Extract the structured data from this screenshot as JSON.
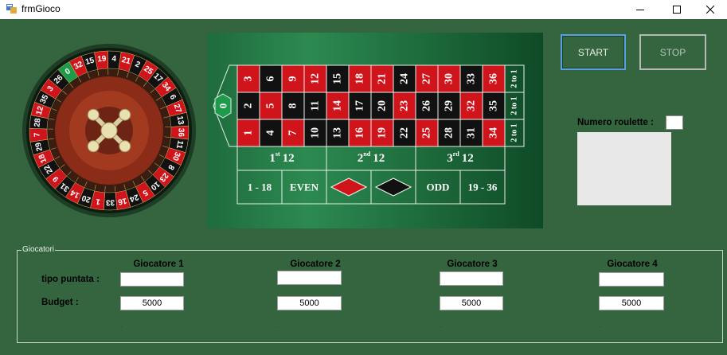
{
  "window": {
    "title": "frmGioco"
  },
  "wheel": {
    "numbers": [
      "0",
      "32",
      "15",
      "19",
      "4",
      "21",
      "2",
      "25",
      "17",
      "34",
      "6",
      "27",
      "13",
      "36",
      "11",
      "30",
      "8",
      "23",
      "10",
      "5",
      "24",
      "16",
      "33",
      "1",
      "20",
      "14",
      "31",
      "9",
      "22",
      "18",
      "29",
      "7",
      "28",
      "12",
      "35",
      "3",
      "26"
    ]
  },
  "board": {
    "zero": "0",
    "rows": [
      [
        "3",
        "6",
        "9",
        "12",
        "15",
        "18",
        "21",
        "24",
        "27",
        "30",
        "33",
        "36"
      ],
      [
        "2",
        "5",
        "8",
        "11",
        "14",
        "17",
        "20",
        "23",
        "26",
        "29",
        "32",
        "35"
      ],
      [
        "1",
        "4",
        "7",
        "10",
        "13",
        "16",
        "19",
        "22",
        "25",
        "28",
        "31",
        "34"
      ]
    ],
    "red_numbers": [
      "1",
      "3",
      "5",
      "7",
      "9",
      "12",
      "14",
      "16",
      "18",
      "19",
      "21",
      "23",
      "25",
      "27",
      "30",
      "32",
      "34",
      "36"
    ],
    "column_bets": [
      "2 to 1",
      "2 to 1",
      "2 to 1"
    ],
    "dozens": [
      {
        "num": "1",
        "sup": "st",
        "label": "12"
      },
      {
        "num": "2",
        "sup": "nd",
        "label": "12"
      },
      {
        "num": "3",
        "sup": "rd",
        "label": "12"
      }
    ],
    "outside": [
      "1 - 18",
      "EVEN",
      "",
      "",
      "ODD",
      "19 - 36"
    ],
    "colors": {
      "red": "#d0141c",
      "black": "#111111",
      "green": "#1e9b4a"
    }
  },
  "controls": {
    "start_label": "START",
    "stop_label": "STOP",
    "numero_label": "Numero roulette :"
  },
  "group": {
    "title": "Giocatori",
    "tipo_label": "tipo puntata :",
    "budget_label": "Budget :",
    "players": [
      {
        "name": "Giocatore 1",
        "tipo": "",
        "budget": "5000",
        "status": "."
      },
      {
        "name": "Giocatore 2",
        "tipo": "",
        "budget": "5000",
        "status": "."
      },
      {
        "name": "Giocatore 3",
        "tipo": "",
        "budget": "5000",
        "status": "."
      },
      {
        "name": "Giocatore 4",
        "tipo": "",
        "budget": "5000",
        "status": "."
      }
    ]
  }
}
